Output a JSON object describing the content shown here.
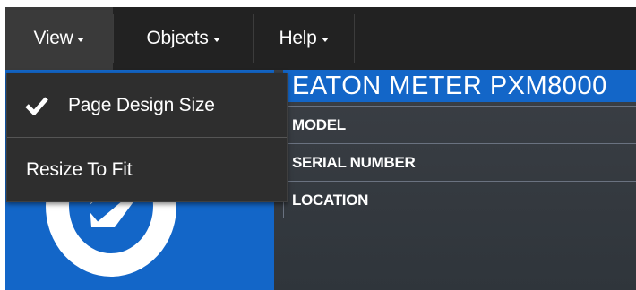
{
  "menubar": {
    "items": [
      {
        "label": "View",
        "icon": "caret-down-icon"
      },
      {
        "label": "Objects",
        "icon": "caret-down-icon"
      },
      {
        "label": "Help",
        "icon": "caret-down-icon"
      }
    ]
  },
  "view_menu": {
    "items": [
      {
        "label": "Page Design Size",
        "checked": true,
        "icon": "checkmark-icon"
      },
      {
        "label": "Resize To Fit",
        "checked": false
      }
    ]
  },
  "device": {
    "title": "EATON METER PXM8000",
    "rows": [
      {
        "label": "MODEL"
      },
      {
        "label": "SERIAL NUMBER"
      },
      {
        "label": "LOCATION"
      }
    ]
  },
  "colors": {
    "menubar": "#222222",
    "brand_blue": "#1366c8",
    "dropdown_bg": "#2e2e2e"
  }
}
